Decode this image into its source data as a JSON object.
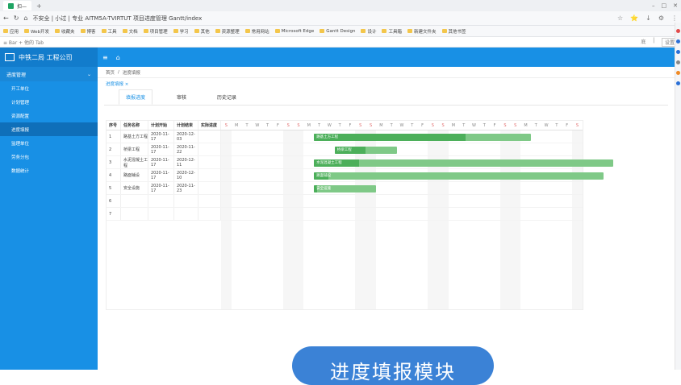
{
  "browser": {
    "tab_title": "扣—",
    "new_tab": "+",
    "window_controls": [
      "–",
      "□",
      "✕"
    ],
    "nav_buttons": [
      "←",
      "↻",
      "⌂"
    ],
    "url": "不安全 | 小过 | 专业 AITM5A-TVIRTUT 项目进度管理 Gantt/index",
    "toolbar_icons": [
      "☆",
      "⭐",
      "↓",
      "⚙",
      "⋮"
    ],
    "bookmarks": [
      "应用",
      "Web开发",
      "收藏夹",
      "博客",
      "工具",
      "文档",
      "项目管理",
      "学习",
      "其他",
      "资源整理",
      "常用网站",
      "Microsoft Edge",
      "Gantt Design",
      "设计",
      "工具箱",
      "新建文件夹",
      "其他书签"
    ],
    "page_header_left": "≡  Bar + 他的 Tab",
    "page_header_right": [
      "底",
      "│",
      "设置"
    ]
  },
  "app": {
    "company": "中铁二局 工程公司",
    "topbar_icons": [
      "≡",
      "⌂"
    ],
    "menu_group": "进度管理",
    "menu_items": [
      "开工单位",
      "计划管理",
      "资源配置",
      "进度填报",
      "监理单位",
      "劳务分包",
      "数据统计"
    ],
    "active_menu_index": 3,
    "breadcrumb": [
      "首页",
      "/",
      "进度填报"
    ],
    "page_tab": "进度填报 ×",
    "subtabs": [
      "填报进度",
      "审核",
      "历史记录"
    ]
  },
  "gantt": {
    "headers": [
      "序号",
      "任务名称",
      "计划开始",
      "计划结束",
      "实际进度"
    ],
    "day_letters": [
      "S",
      "M",
      "T",
      "W",
      "T",
      "F",
      "S",
      "S",
      "M",
      "T",
      "W",
      "T",
      "F",
      "S",
      "S",
      "M",
      "T",
      "W",
      "T",
      "F",
      "S",
      "S",
      "M",
      "T",
      "W",
      "T",
      "F",
      "S",
      "S",
      "M",
      "T",
      "W",
      "T",
      "F",
      "S"
    ],
    "rows": [
      {
        "num": "1",
        "name": "路基土方工程",
        "start": "2020-11-17",
        "end": "2020-12-03",
        "progress": "",
        "bar_start": 9,
        "bar_len": 21,
        "done": 0.7,
        "label": "路基土方工程"
      },
      {
        "num": "2",
        "name": "桥梁工程",
        "start": "2020-11-17",
        "end": "2020-11-22",
        "progress": "",
        "bar_start": 11,
        "bar_len": 6,
        "done": 0.5,
        "label": "桥梁工程"
      },
      {
        "num": "3",
        "name": "水泥混凝土工程",
        "start": "2020-11-17",
        "end": "2020-12-11",
        "progress": "",
        "bar_start": 9,
        "bar_len": 29,
        "done": 0.15,
        "label": "水泥混凝土工程"
      },
      {
        "num": "4",
        "name": "路面铺设",
        "start": "2020-11-17",
        "end": "2020-12-10",
        "progress": "",
        "bar_start": 9,
        "bar_len": 28,
        "done": 0.05,
        "label": "路面铺设"
      },
      {
        "num": "5",
        "name": "安全设施",
        "start": "2020-11-17",
        "end": "2020-11-23",
        "progress": "",
        "bar_start": 9,
        "bar_len": 6,
        "done": 0.05,
        "label": "安全设施"
      },
      {
        "num": "6",
        "name": "",
        "start": "",
        "end": "",
        "progress": "",
        "bar_start": null
      },
      {
        "num": "7",
        "name": "",
        "start": "",
        "end": "",
        "progress": "",
        "bar_start": null
      }
    ]
  },
  "overlay": {
    "text": "进度填报模块"
  },
  "colors": {
    "brand": "#1890e5",
    "bar": "#7fc987",
    "bar_done": "#4caf5a",
    "pill": "#3b82d6"
  }
}
